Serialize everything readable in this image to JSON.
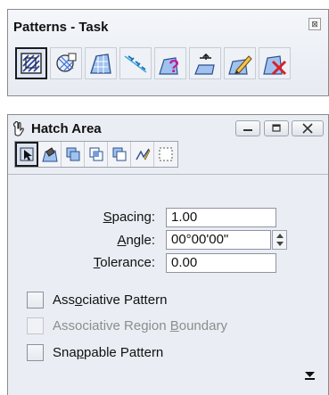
{
  "patterns_task": {
    "title": "Patterns - Task",
    "close_glyph": "⊠",
    "tools": [
      {
        "icon": "hatch-area-icon",
        "active": true
      },
      {
        "icon": "crosshatch-area-icon",
        "active": false
      },
      {
        "icon": "pattern-area-icon",
        "active": false
      },
      {
        "icon": "linear-pattern-icon",
        "active": false
      },
      {
        "icon": "show-pattern-attributes-icon",
        "active": false
      },
      {
        "icon": "match-pattern-attributes-icon",
        "active": false
      },
      {
        "icon": "edit-pattern-icon",
        "active": false
      },
      {
        "icon": "delete-pattern-icon",
        "active": false
      }
    ]
  },
  "hatch_area": {
    "title": "Hatch Area",
    "tools": [
      "element-method-icon",
      "flood-method-icon",
      "union-method-icon",
      "intersection-method-icon",
      "difference-method-icon",
      "points-method-icon",
      "fence-method-icon"
    ],
    "fields": {
      "spacing": {
        "label_pre": "",
        "label_u": "S",
        "label_post": "pacing:",
        "value": "1.00"
      },
      "angle": {
        "label_pre": "",
        "label_u": "A",
        "label_post": "ngle:",
        "value": "00°00'00\""
      },
      "tolerance": {
        "label_pre": "",
        "label_u": "T",
        "label_post": "olerance:",
        "value": "0.00"
      }
    },
    "checkboxes": {
      "associative_pattern": {
        "pre": "Ass",
        "u": "o",
        "post": "ciative Pattern",
        "checked": false,
        "enabled": true
      },
      "associative_region_boundary": {
        "pre": "Associative Region ",
        "u": "B",
        "post": "oundary",
        "checked": false,
        "enabled": false
      },
      "snappable_pattern": {
        "pre": "Sna",
        "u": "p",
        "post": "pable Pattern",
        "checked": false,
        "enabled": true
      }
    }
  }
}
